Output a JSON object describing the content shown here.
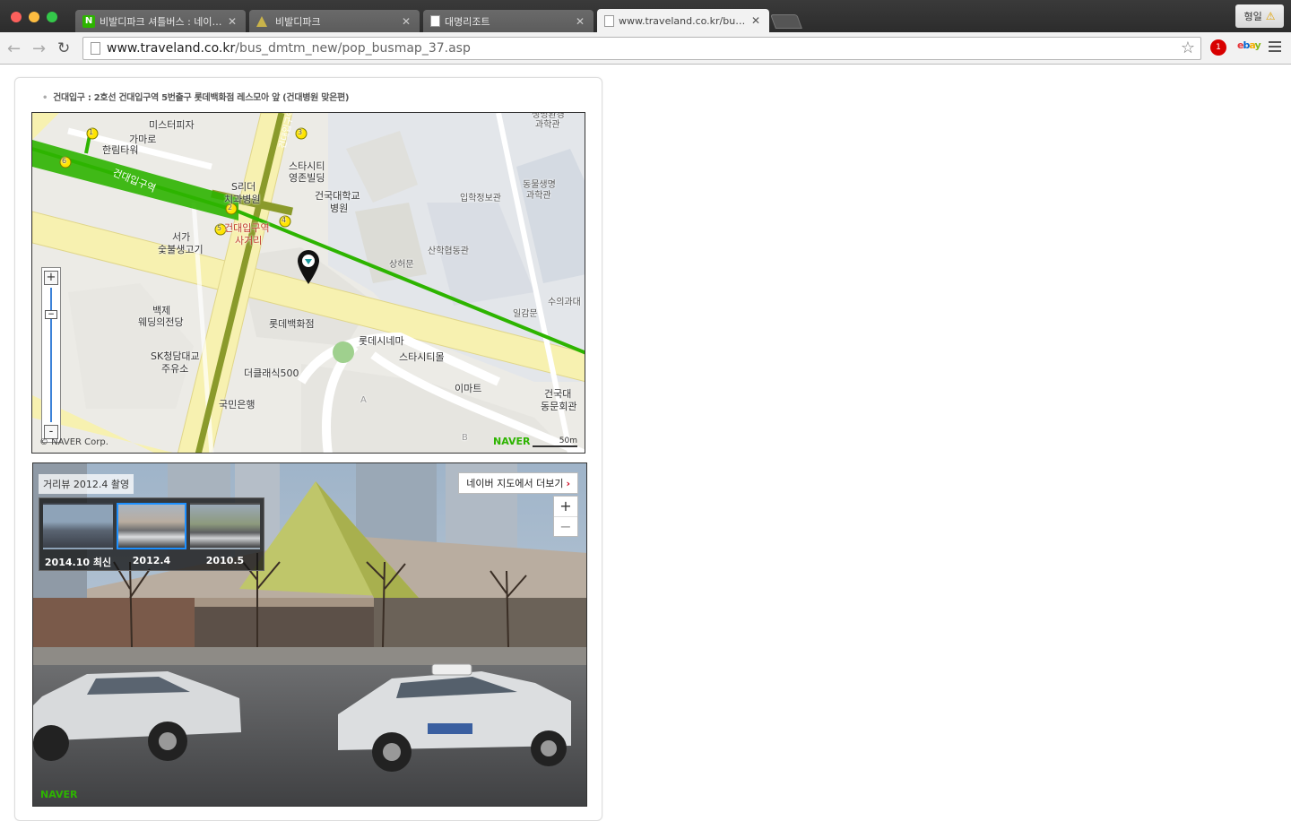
{
  "browser": {
    "tabs": [
      {
        "title": "비발디파크 셔틀버스 : 네이버 통",
        "favicon": "naver-icon"
      },
      {
        "title": "비발디파크",
        "favicon": "triangle-icon"
      },
      {
        "title": "대명리조트",
        "favicon": "document-icon"
      },
      {
        "title": "www.traveland.co.kr/bus_d",
        "favicon": "document-icon",
        "active": true
      }
    ],
    "profile_name": "형일",
    "url_host": "www.traveland.co.kr",
    "url_path": "/bus_dmtm_new/pop_busmap_37.asp",
    "adblock_count": "1"
  },
  "page": {
    "caption": "건대입구 : 2호선 건대입구역 5번출구 롯데백화점 레스모아 앞 (건대병원 맞은편)"
  },
  "map": {
    "labels": {
      "mister_pizza": "미스터피자",
      "gamaro": "가마로",
      "hallim_tower": "한림타워",
      "kd_station_road": "건대입구역",
      "s_leader": "S리더",
      "dental": "치과병원",
      "star_city": "스타시티",
      "youngjon": "영존빌딩",
      "konkuk_hospital": "건국대학교",
      "hospital": "병원",
      "ipak": "입학정보관",
      "animal_1": "동물생명",
      "animal_2": "과학관",
      "life_1": "생명환경",
      "life_2": "과학관",
      "kd_crossing_1": "건대입구역",
      "kd_crossing_2": "사거리",
      "seoga_1": "서가",
      "seoga_2": "숯불생고기",
      "sanhak": "산학협동관",
      "sangheo": "상허문",
      "ilgam": "일감문",
      "suui": "수의과대",
      "baekje_1": "백제",
      "baekje_2": "웨딩의전당",
      "lotte_dept": "롯데백화점",
      "lotte_cinema": "롯데시네마",
      "starcity_mall": "스타시티몰",
      "sk_1": "SK청담대교",
      "sk_2": "주유소",
      "classic500": "더클래식500",
      "kookmin": "국민은행",
      "emart": "이마트",
      "kd_alumni_1": "건국대",
      "kd_alumni_2": "동문회관",
      "side_road": "건대입구역",
      "block_a": "A",
      "block_b": "B"
    },
    "exit_numbers": [
      "1",
      "3",
      "6",
      "2",
      "4",
      "5"
    ],
    "copyright": "© NAVER Corp.",
    "naver": "NAVER",
    "scale": "50m",
    "zoom_in": "+",
    "zoom_out": "-"
  },
  "streetview": {
    "date_label": "거리뷰 2012.4 촬영",
    "more_link": "네이버 지도에서 더보기",
    "zoom_in": "+",
    "zoom_out": "−",
    "thumbs": [
      {
        "label": "2014.10 최신"
      },
      {
        "label": "2012.4",
        "selected": true
      },
      {
        "label": "2010.5"
      }
    ],
    "naver": "NAVER"
  },
  "colors": {
    "subway_line": "#2db400",
    "road_yellow": "#f7f1b0",
    "road_olive": "#8a9a2b",
    "thumb_selected": "#1e90ff"
  }
}
